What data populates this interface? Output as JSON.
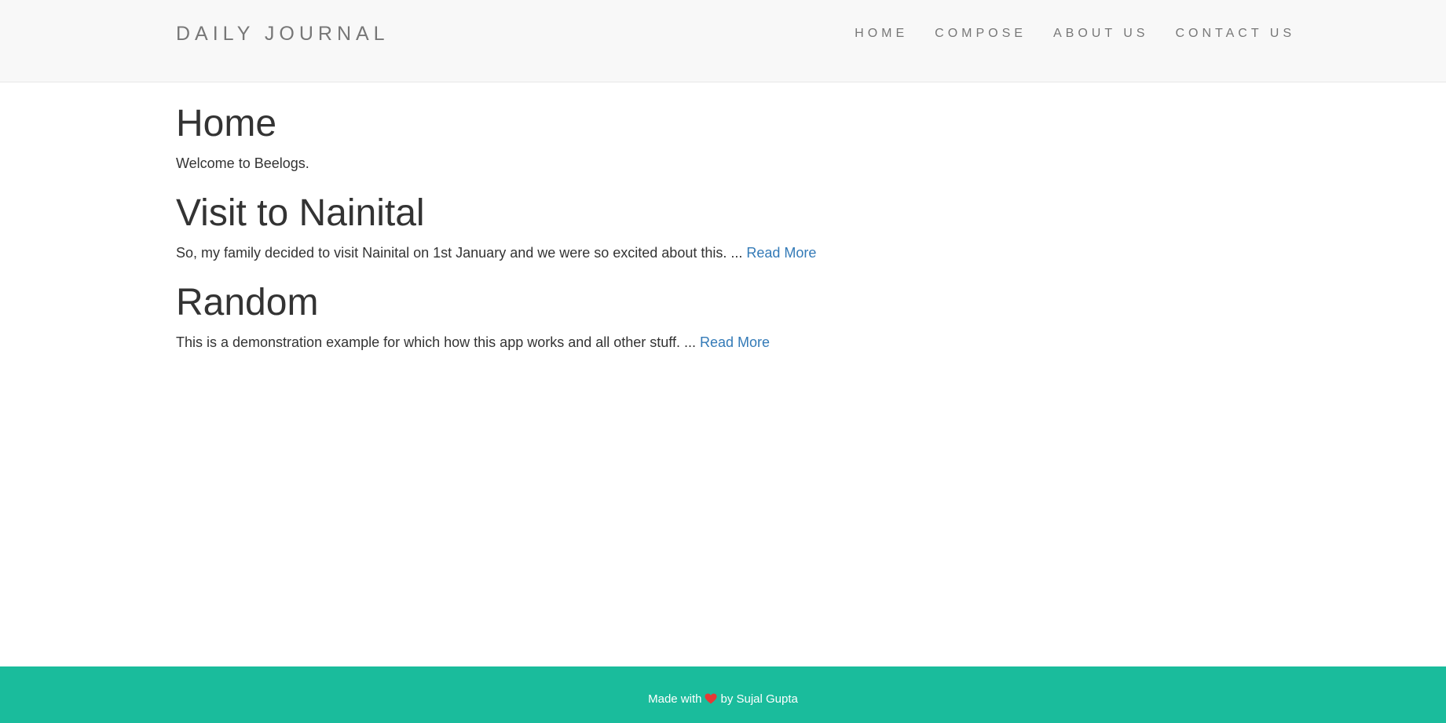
{
  "navbar": {
    "brand": "DAILY JOURNAL",
    "links": [
      {
        "label": "HOME"
      },
      {
        "label": "COMPOSE"
      },
      {
        "label": "ABOUT US"
      },
      {
        "label": "CONTACT US"
      }
    ]
  },
  "home": {
    "title": "Home",
    "intro": "Welcome to Beelogs."
  },
  "posts": [
    {
      "title": "Visit to Nainital",
      "excerpt": "So, my family decided to visit Nainital on 1st January and we were so excited about this. ... ",
      "link_label": "Read More"
    },
    {
      "title": "Random",
      "excerpt": "This is a demonstration example for which how this app works and all other stuff. ... ",
      "link_label": "Read More"
    }
  ],
  "footer": {
    "prefix": "Made with",
    "suffix": "by Sujal Gupta",
    "heart_icon": "heart-icon",
    "heart_color": "#e53935",
    "background_color": "#1abc9c"
  }
}
